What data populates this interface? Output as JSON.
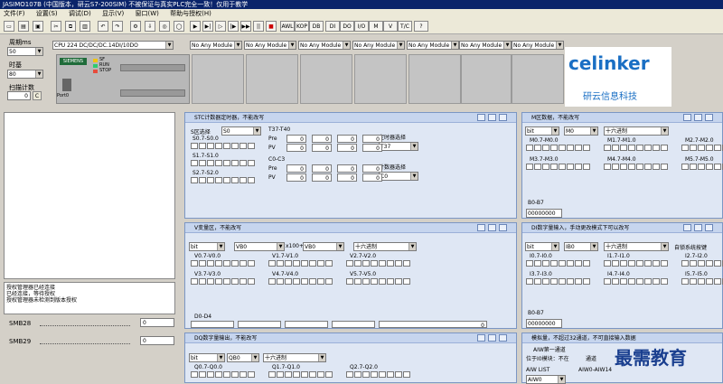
{
  "window": {
    "title": "JASIMO107B (中国版本，研云S7-200SIM) 不被保证与真实PLC完全一致！仅用于教学"
  },
  "menu": [
    "文件(F)",
    "设置(S)",
    "调试(D)",
    "显示(V)",
    "窗口(W)",
    "帮助与授权(H)"
  ],
  "toolbar": {
    "buttons": [
      "AWL",
      "KOP",
      "DB",
      "DI",
      "DO",
      "I/O",
      "M",
      "V",
      "T/C",
      "?"
    ]
  },
  "config": {
    "cycle_label": "周期ms",
    "cycle_value": "50",
    "clock_label": "时基",
    "clock_value": "80",
    "scan_label": "扫描计数",
    "scan_value": "0",
    "scan_btn": "C",
    "cpu_select": "CPU 224 DC/DC/DC.14DI/10DO",
    "module_label": "No Any Module",
    "plc_brand": "SIEMENS",
    "leds": [
      "SF",
      "RUN",
      "STOP"
    ],
    "port": "Port0"
  },
  "logo": {
    "name": "celinker",
    "subtitle": "研云信息科技"
  },
  "log": {
    "lines": [
      "授权管理器已经连接",
      "已经连接，等待授权",
      "授权管理器未检测到版本授权"
    ]
  },
  "smb": {
    "smb28_label": "SMB28",
    "smb28_value": "0",
    "smb29_label": "SMB29",
    "smb29_value": "0"
  },
  "stc": {
    "title": "STC计数器定时器，不能改写",
    "s_select_label": "S区选择",
    "s_select": "S0",
    "rows": [
      "S0.7-S0.0",
      "S1.7-S1.0",
      "S2.7-S2.0"
    ],
    "t_label": "T37-T40",
    "c_label": "C0-C3",
    "pre": "Pre",
    "pv": "PV",
    "zero": "0",
    "timer_label": "定时器选择",
    "timer_value": "T37",
    "counter_label": "计数器选择",
    "counter_value": "C0"
  },
  "m_area": {
    "title": "M区数据，不能改写",
    "type": "bit",
    "start": "M0",
    "fmt": "十六进制",
    "groups": [
      "M0.7-M0.0",
      "M1.7-M1.0",
      "M2.7-M2.0",
      "M3.7-M3.0",
      "M4.7-M4.0",
      "M5.7-M5.0"
    ],
    "b_label": "B0-B7",
    "b_value": "00000000"
  },
  "v_area": {
    "title": "V变量区，不能改写",
    "type": "bit",
    "start": "VB0",
    "mult": "x100+",
    "start2": "VB0",
    "fmt": "十六进制",
    "groups": [
      "V0.7-V0.0",
      "V1.7-V1.0",
      "V2.7-V2.0",
      "V3.7-V3.0",
      "V4.7-V4.0",
      "V5.7-V5.0"
    ],
    "d_label": "D0-D4",
    "d_value": "0"
  },
  "di_area": {
    "title": "DI数字量输入，手动更改模式下可以改写",
    "type": "bit",
    "start": "IB0",
    "fmt": "十六进制",
    "auto": "自锁系统按键",
    "groups": [
      "I0.7-I0.0",
      "I1.7-I1.0",
      "I2.7-I2.0",
      "I3.7-I3.0",
      "I4.7-I4.0",
      "I5.7-I5.0"
    ],
    "b_label": "B0-B7",
    "b_value": "00000000"
  },
  "dq_area": {
    "title": "DQ数字量输出，不能改写",
    "type": "bit",
    "start": "QB0",
    "fmt": "十六进制",
    "groups": [
      "Q0.7-Q0.0",
      "Q1.7-Q1.0",
      "Q2.7-Q2.0"
    ]
  },
  "ai_area": {
    "title": "模拟量，不超过32通道，不可直接输入数据",
    "channel": "AIW第一通道",
    "pos_label": "位于I0模块：不在",
    "ch_label": "通道",
    "list_label": "AIW LIST",
    "aiw_label": "AIW0-AIW14",
    "aiw_value": "AIW0"
  },
  "watermark": "最需教育"
}
